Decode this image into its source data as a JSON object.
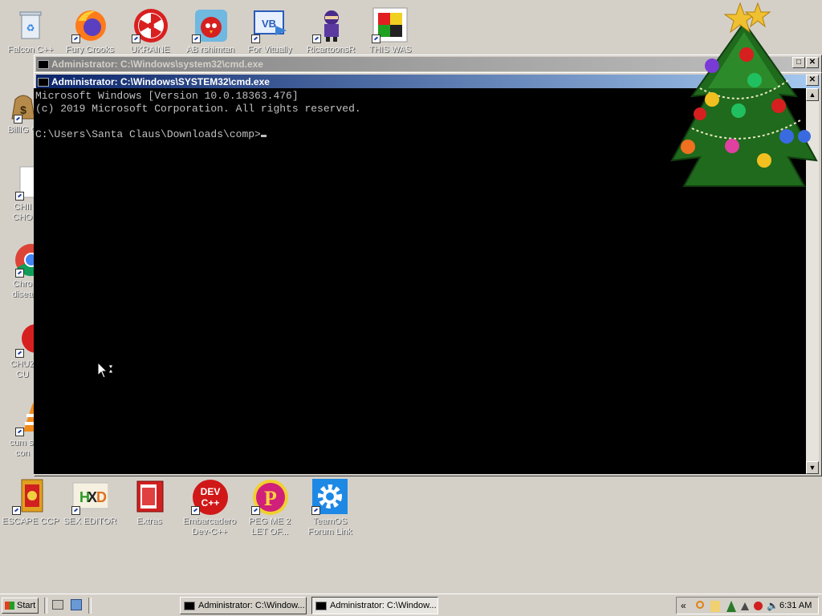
{
  "desktop": {
    "top_icons": [
      {
        "label": "Falcon C++",
        "icon": "recycle-bin-icon"
      },
      {
        "label": "Fury Crooks",
        "icon": "firefox-icon"
      },
      {
        "label": "UKRAINE",
        "icon": "radiation-icon"
      },
      {
        "label": "AB rshimtan",
        "icon": "angry-bird-icon"
      },
      {
        "label": "For Vitually",
        "icon": "vb-icon"
      },
      {
        "label": "RicartoonsR",
        "icon": "ninja-icon"
      },
      {
        "label": "THIS WAS",
        "icon": "colored-square-icon"
      }
    ],
    "left_icons": [
      {
        "label1": "BillIG C",
        "label2": "",
        "icon": "money-bag-icon"
      },
      {
        "label1": "CHII",
        "label2": "CHO",
        "icon": "document-icon"
      },
      {
        "label1": "Chro",
        "label2": "disea",
        "icon": "chrome-icon"
      },
      {
        "label1": "CHUZ",
        "label2": "CU",
        "icon": "red-ball-icon"
      },
      {
        "label1": "cum st",
        "label2": "con",
        "icon": "vlc-cone-icon"
      }
    ],
    "bottom_icons": [
      {
        "label1": "ESCAPE CCP",
        "label2": "",
        "icon": "chinese-book-icon"
      },
      {
        "label1": "SEX EDITOR",
        "label2": "",
        "icon": "hxd-icon"
      },
      {
        "label1": "Extras",
        "label2": "",
        "icon": "red-folder-icon"
      },
      {
        "label1": "Embarcadero",
        "label2": "Dev-C++",
        "icon": "devcpp-icon"
      },
      {
        "label1": "PEG ME 2",
        "label2": "LET OF...",
        "icon": "p-logo-icon"
      },
      {
        "label1": "TeamOS",
        "label2": "Forum Link",
        "icon": "gear-icon"
      }
    ]
  },
  "back_window": {
    "title": "Administrator: C:\\Windows\\system32\\cmd.exe"
  },
  "front_window": {
    "title": "Administrator: C:\\Windows\\SYSTEM32\\cmd.exe",
    "console_lines": [
      "Microsoft Windows [Version 10.0.18363.476]",
      "(c) 2019 Microsoft Corporation. All rights reserved.",
      "",
      "C:\\Users\\Santa Claus\\Downloads\\comp>"
    ]
  },
  "taskbar": {
    "start_label": "Start",
    "tasks": [
      {
        "label": "Administrator: C:\\Window...",
        "active": false
      },
      {
        "label": "Administrator: C:\\Window...",
        "active": true
      }
    ],
    "tray_chevron": "«",
    "clock": "6:31 AM"
  },
  "colors": {
    "desktop": "#d4d0c8",
    "title_active_start": "#0a246a",
    "title_active_end": "#a6caf0",
    "console_bg": "#000000",
    "console_fg": "#c0c0c0"
  }
}
